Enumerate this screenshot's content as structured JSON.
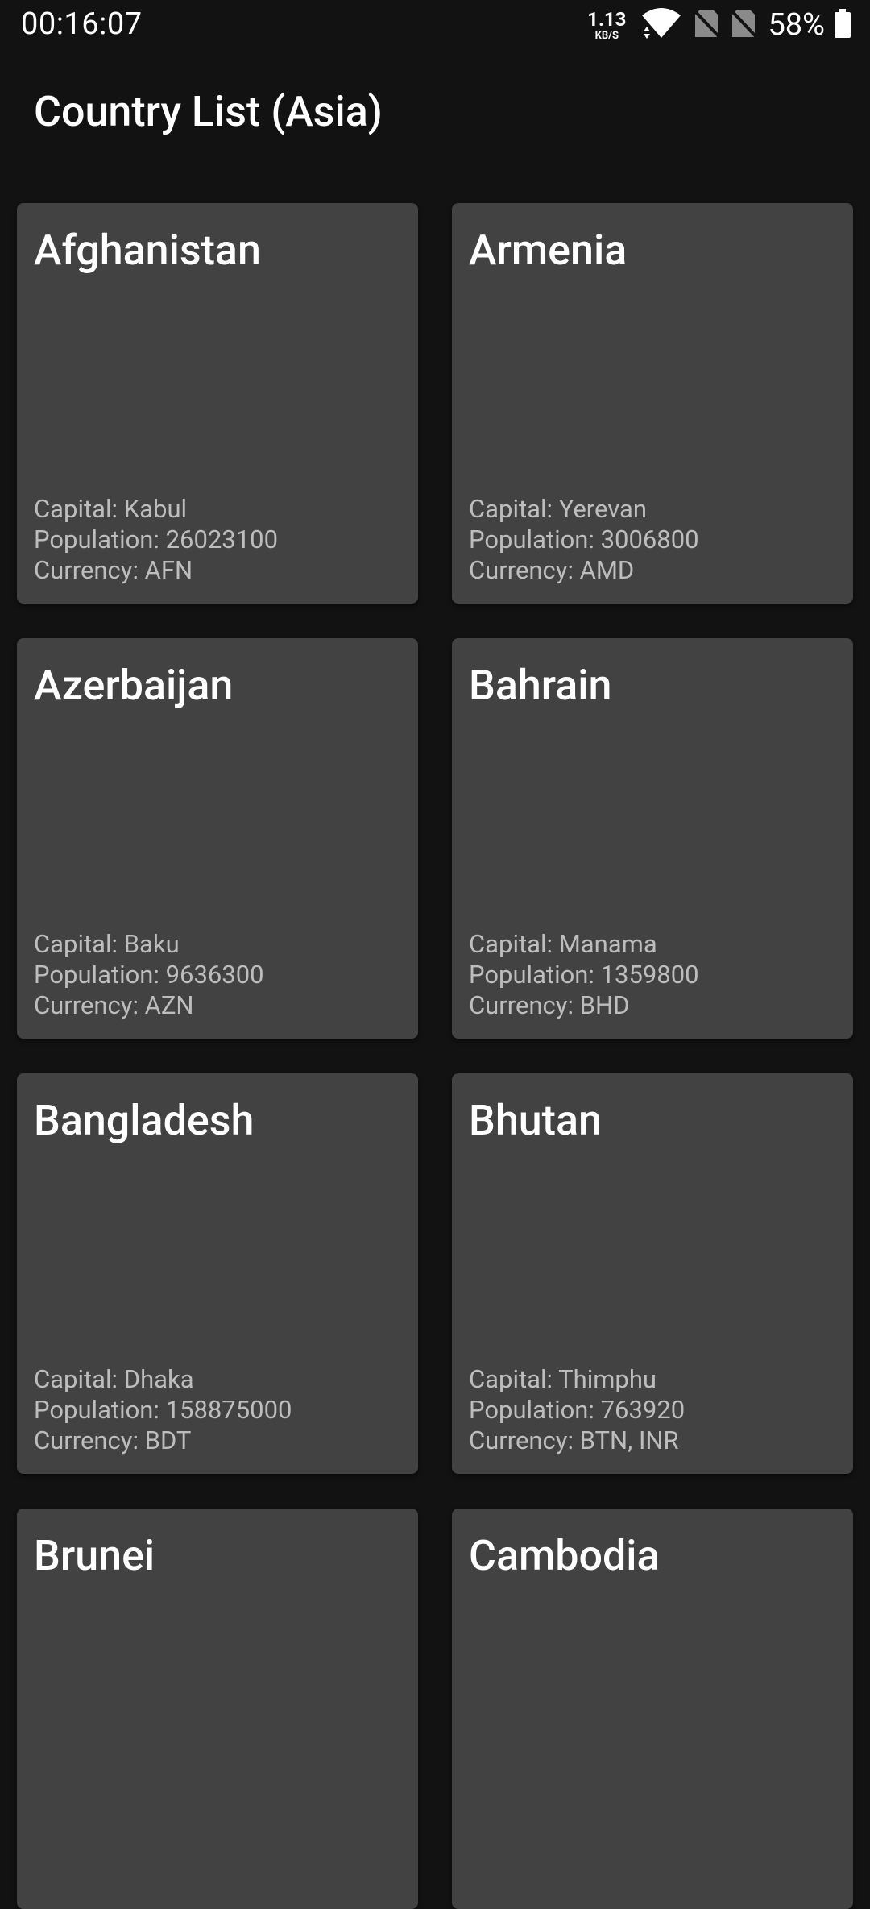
{
  "status_bar": {
    "time": "00:16:07",
    "net_speed_value": "1.13",
    "net_speed_unit": "KB/S",
    "battery_percent": "58%"
  },
  "page": {
    "title": "Country List (Asia)"
  },
  "countries": [
    {
      "name": "Afghanistan",
      "capital": "Capital: Kabul",
      "population": "Population: 26023100",
      "currency": "Currency: AFN"
    },
    {
      "name": "Armenia",
      "capital": "Capital: Yerevan",
      "population": "Population: 3006800",
      "currency": "Currency: AMD"
    },
    {
      "name": "Azerbaijan",
      "capital": "Capital: Baku",
      "population": "Population: 9636300",
      "currency": "Currency: AZN"
    },
    {
      "name": "Bahrain",
      "capital": "Capital: Manama",
      "population": "Population: 1359800",
      "currency": "Currency: BHD"
    },
    {
      "name": "Bangladesh",
      "capital": "Capital: Dhaka",
      "population": "Population: 158875000",
      "currency": "Currency: BDT"
    },
    {
      "name": "Bhutan",
      "capital": "Capital: Thimphu",
      "population": "Population: 763920",
      "currency": "Currency: BTN, INR"
    },
    {
      "name": "Brunei",
      "capital": "",
      "population": "",
      "currency": ""
    },
    {
      "name": "Cambodia",
      "capital": "",
      "population": "",
      "currency": ""
    }
  ]
}
